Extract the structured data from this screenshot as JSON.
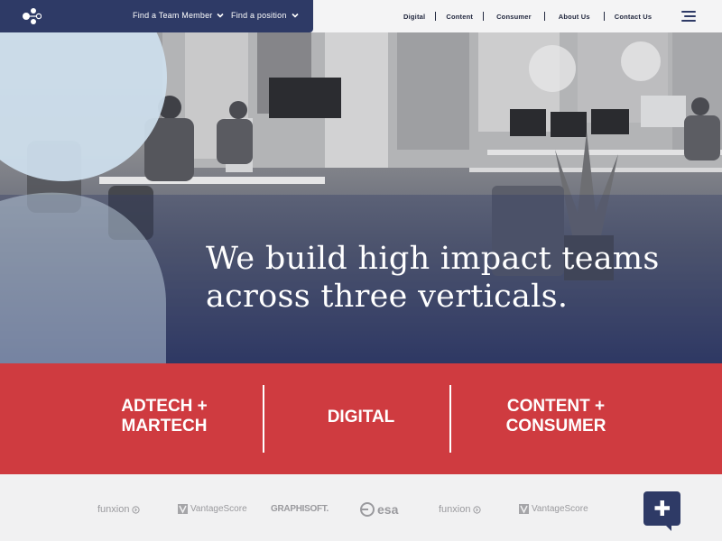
{
  "header": {
    "nav_dropdowns": [
      {
        "label": "Find a Team Member"
      },
      {
        "label": "Find a position"
      }
    ],
    "nav_links": [
      {
        "label": "Digital"
      },
      {
        "label": "Content"
      },
      {
        "label": "Consumer"
      },
      {
        "label": "About Us"
      },
      {
        "label": "Contact Us"
      }
    ],
    "menu_icon": "hamburger-icon",
    "logo_icon": "network-nodes-icon"
  },
  "hero": {
    "headline_line1": "We build high impact teams",
    "headline_line2": "across three verticals."
  },
  "verticals": [
    {
      "label": "ADTECH +\nMARTECH"
    },
    {
      "label": "DIGITAL"
    },
    {
      "label": "CONTENT +\nCONSUMER"
    }
  ],
  "client_logos": [
    {
      "name": "funxion"
    },
    {
      "name": "VantageScore"
    },
    {
      "name": "GRAPHISOFT."
    },
    {
      "name": "esa"
    },
    {
      "name": "funxion"
    },
    {
      "name": "VantageScore"
    }
  ],
  "chat_button": {
    "icon": "plus-icon"
  },
  "colors": {
    "brand_navy": "#2e3a66",
    "accent_red": "#cf3b40",
    "light_blue_shape": "#cfe0ee",
    "logo_gray": "#9a9a9e"
  }
}
